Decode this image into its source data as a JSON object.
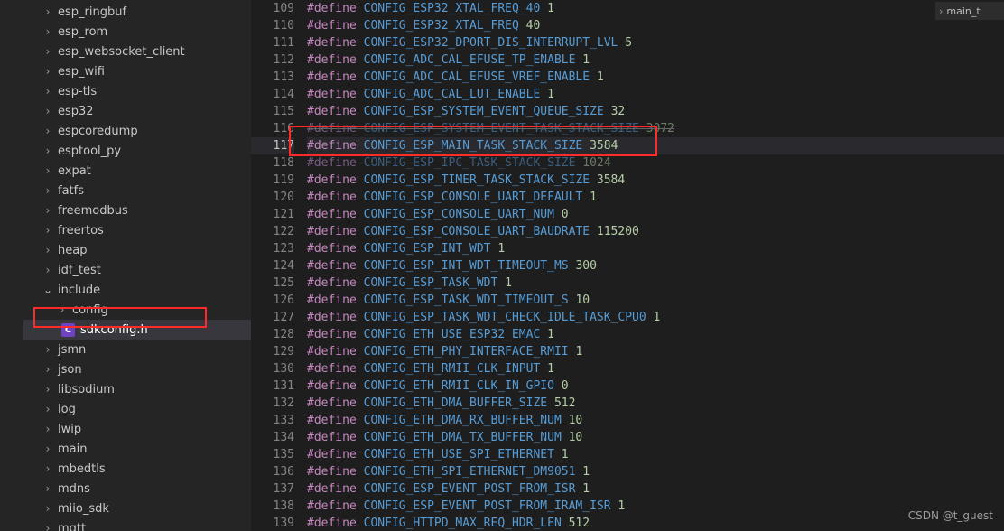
{
  "sidebar": {
    "items": [
      {
        "label": "esp_ringbuf",
        "expandable": true
      },
      {
        "label": "esp_rom",
        "expandable": true
      },
      {
        "label": "esp_websocket_client",
        "expandable": true
      },
      {
        "label": "esp_wifi",
        "expandable": true
      },
      {
        "label": "esp-tls",
        "expandable": true
      },
      {
        "label": "esp32",
        "expandable": true
      },
      {
        "label": "espcoredump",
        "expandable": true
      },
      {
        "label": "esptool_py",
        "expandable": true
      },
      {
        "label": "expat",
        "expandable": true
      },
      {
        "label": "fatfs",
        "expandable": true
      },
      {
        "label": "freemodbus",
        "expandable": true
      },
      {
        "label": "freertos",
        "expandable": true
      },
      {
        "label": "heap",
        "expandable": true
      },
      {
        "label": "idf_test",
        "expandable": true
      },
      {
        "label": "include",
        "expandable": true,
        "expanded": true,
        "children": [
          {
            "label": "config",
            "expandable": true,
            "level": 2
          },
          {
            "label": "sdkconfig.h",
            "file": true,
            "badge": "C",
            "level": 3,
            "active": true
          }
        ]
      },
      {
        "label": "jsmn",
        "expandable": true
      },
      {
        "label": "json",
        "expandable": true
      },
      {
        "label": "libsodium",
        "expandable": true
      },
      {
        "label": "log",
        "expandable": true
      },
      {
        "label": "lwip",
        "expandable": true
      },
      {
        "label": "main",
        "expandable": true
      },
      {
        "label": "mbedtls",
        "expandable": true
      },
      {
        "label": "mdns",
        "expandable": true
      },
      {
        "label": "miio_sdk",
        "expandable": true
      },
      {
        "label": "mqtt",
        "expandable": true
      }
    ]
  },
  "breadcrumb": {
    "label": "main_t"
  },
  "editor": {
    "startLine": 109,
    "cursorLine": 117,
    "lines": [
      {
        "name": "CONFIG_ESP32_XTAL_FREQ_40",
        "val": "1"
      },
      {
        "name": "CONFIG_ESP32_XTAL_FREQ",
        "val": "40"
      },
      {
        "name": "CONFIG_ESP32_DPORT_DIS_INTERRUPT_LVL",
        "val": "5"
      },
      {
        "name": "CONFIG_ADC_CAL_EFUSE_TP_ENABLE",
        "val": "1"
      },
      {
        "name": "CONFIG_ADC_CAL_EFUSE_VREF_ENABLE",
        "val": "1"
      },
      {
        "name": "CONFIG_ADC_CAL_LUT_ENABLE",
        "val": "1"
      },
      {
        "name": "CONFIG_ESP_SYSTEM_EVENT_QUEUE_SIZE",
        "val": "32"
      },
      {
        "name": "CONFIG_ESP_SYSTEM_EVENT_TASK_STACK_SIZE",
        "val": "3072",
        "strike": true
      },
      {
        "name": "CONFIG_ESP_MAIN_TASK_STACK_SIZE",
        "val": "3584"
      },
      {
        "name": "CONFIG_ESP_IPC_TASK_STACK_SIZE",
        "val": "1024",
        "strike": true
      },
      {
        "name": "CONFIG_ESP_TIMER_TASK_STACK_SIZE",
        "val": "3584"
      },
      {
        "name": "CONFIG_ESP_CONSOLE_UART_DEFAULT",
        "val": "1"
      },
      {
        "name": "CONFIG_ESP_CONSOLE_UART_NUM",
        "val": "0"
      },
      {
        "name": "CONFIG_ESP_CONSOLE_UART_BAUDRATE",
        "val": "115200"
      },
      {
        "name": "CONFIG_ESP_INT_WDT",
        "val": "1"
      },
      {
        "name": "CONFIG_ESP_INT_WDT_TIMEOUT_MS",
        "val": "300"
      },
      {
        "name": "CONFIG_ESP_TASK_WDT",
        "val": "1"
      },
      {
        "name": "CONFIG_ESP_TASK_WDT_TIMEOUT_S",
        "val": "10"
      },
      {
        "name": "CONFIG_ESP_TASK_WDT_CHECK_IDLE_TASK_CPU0",
        "val": "1"
      },
      {
        "name": "CONFIG_ETH_USE_ESP32_EMAC",
        "val": "1"
      },
      {
        "name": "CONFIG_ETH_PHY_INTERFACE_RMII",
        "val": "1"
      },
      {
        "name": "CONFIG_ETH_RMII_CLK_INPUT",
        "val": "1"
      },
      {
        "name": "CONFIG_ETH_RMII_CLK_IN_GPIO",
        "val": "0"
      },
      {
        "name": "CONFIG_ETH_DMA_BUFFER_SIZE",
        "val": "512"
      },
      {
        "name": "CONFIG_ETH_DMA_RX_BUFFER_NUM",
        "val": "10"
      },
      {
        "name": "CONFIG_ETH_DMA_TX_BUFFER_NUM",
        "val": "10"
      },
      {
        "name": "CONFIG_ETH_USE_SPI_ETHERNET",
        "val": "1"
      },
      {
        "name": "CONFIG_ETH_SPI_ETHERNET_DM9051",
        "val": "1"
      },
      {
        "name": "CONFIG_ESP_EVENT_POST_FROM_ISR",
        "val": "1"
      },
      {
        "name": "CONFIG_ESP_EVENT_POST_FROM_IRAM_ISR",
        "val": "1"
      },
      {
        "name": "CONFIG_HTTPD_MAX_REQ_HDR_LEN",
        "val": "512"
      }
    ]
  },
  "watermark": "CSDN @t_guest"
}
